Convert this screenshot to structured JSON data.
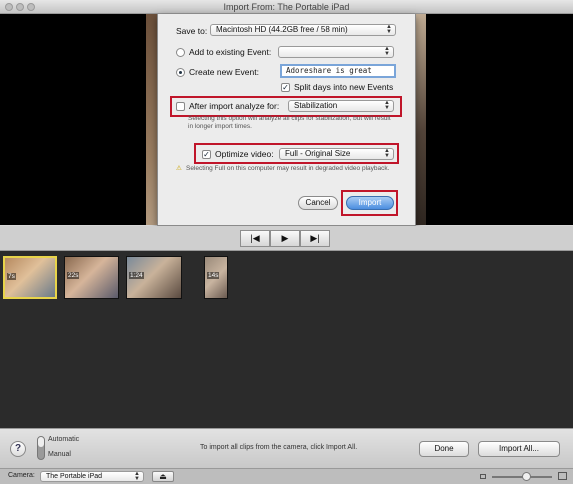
{
  "window": {
    "title": "Import From: The Portable iPad"
  },
  "dialog": {
    "save_to_label": "Save to:",
    "save_to_value": "Macintosh HD (44.2GB free / 58 min)",
    "add_existing_label": "Add to existing Event:",
    "add_existing_value": "",
    "create_new_label": "Create new Event:",
    "new_event_name": "Adoreshare is great",
    "split_days_label": "Split days into new Events",
    "analyze_label": "After import analyze for:",
    "analyze_value": "Stabilization",
    "analyze_note": "Selecting this option will analyze all clips for stabilization, but will result in longer import times.",
    "optimize_label": "Optimize video:",
    "optimize_value": "Full - Original Size",
    "optimize_note": "Selecting Full on this computer may result in degraded video playback.",
    "cancel_label": "Cancel",
    "import_label": "Import"
  },
  "transport": {
    "prev_symbol": "|◀",
    "play_symbol": "▶",
    "next_symbol": "▶|"
  },
  "clips": [
    {
      "duration": "7s"
    },
    {
      "duration": "22s"
    },
    {
      "duration": "1:24"
    },
    {
      "duration": "14s"
    }
  ],
  "bottom": {
    "help_symbol": "?",
    "mode_automatic": "Automatic",
    "mode_manual": "Manual",
    "hint": "To import all clips from the camera, click Import All.",
    "done_label": "Done",
    "import_all_label": "Import All..."
  },
  "status": {
    "camera_label": "Camera:",
    "camera_value": "The Portable iPad",
    "eject_symbol": "⏏"
  },
  "colors": {
    "highlight": "#c0152a",
    "selected_clip": "#e8d44a",
    "primary_button": "#4b8ee0"
  }
}
